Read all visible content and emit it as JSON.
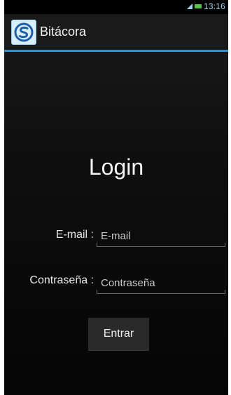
{
  "status_bar": {
    "time": "13:16",
    "icons": [
      "signal-icon",
      "battery-icon"
    ],
    "icon_color": "#9bd1ea",
    "battery_color": "#55c24a"
  },
  "action_bar": {
    "title": "Bitácora",
    "app_icon": "app-logo-icon",
    "accent_color": "#2f93c7"
  },
  "login": {
    "title": "Login",
    "email_label": "E-mail :",
    "email_placeholder": "E-mail",
    "email_value": "",
    "password_label": "Contraseña :",
    "password_placeholder": "Contraseña",
    "password_value": "",
    "submit_label": "Entrar"
  }
}
